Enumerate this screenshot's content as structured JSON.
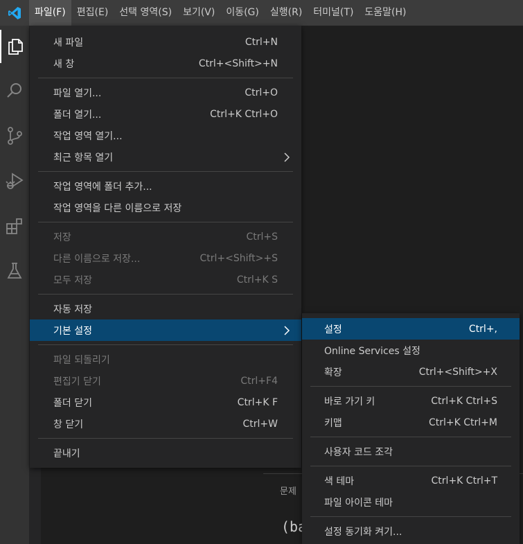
{
  "menubar": {
    "items": [
      {
        "label": "파일(F)",
        "active": true
      },
      {
        "label": "편집(E)"
      },
      {
        "label": "선택 영역(S)"
      },
      {
        "label": "보기(V)"
      },
      {
        "label": "이동(G)"
      },
      {
        "label": "실행(R)"
      },
      {
        "label": "터미널(T)"
      },
      {
        "label": "도움말(H)"
      }
    ]
  },
  "activitybar": {
    "icons": [
      "files-icon",
      "search-icon",
      "source-control-icon",
      "run-debug-icon",
      "extensions-icon",
      "testing-icon"
    ]
  },
  "file_menu": {
    "groups": [
      [
        {
          "label": "새 파일",
          "shortcut": "Ctrl+N"
        },
        {
          "label": "새 창",
          "shortcut": "Ctrl+<Shift>+N"
        }
      ],
      [
        {
          "label": "파일 열기...",
          "shortcut": "Ctrl+O"
        },
        {
          "label": "폴더 열기...",
          "shortcut": "Ctrl+K Ctrl+O"
        },
        {
          "label": "작업 영역 열기...",
          "shortcut": ""
        },
        {
          "label": "최근 항목 열기",
          "shortcut": "",
          "submenu": true
        }
      ],
      [
        {
          "label": "작업 영역에 폴더 추가...",
          "shortcut": ""
        },
        {
          "label": "작업 영역을 다른 이름으로 저장",
          "shortcut": ""
        }
      ],
      [
        {
          "label": "저장",
          "shortcut": "Ctrl+S",
          "disabled": true
        },
        {
          "label": "다른 이름으로 저장...",
          "shortcut": "Ctrl+<Shift>+S",
          "disabled": true
        },
        {
          "label": "모두 저장",
          "shortcut": "Ctrl+K S",
          "disabled": true
        }
      ],
      [
        {
          "label": "자동 저장",
          "shortcut": ""
        },
        {
          "label": "기본 설정",
          "shortcut": "",
          "submenu": true,
          "selected": true
        }
      ],
      [
        {
          "label": "파일 되돌리기",
          "shortcut": "",
          "disabled": true
        },
        {
          "label": "편집기 닫기",
          "shortcut": "Ctrl+F4",
          "disabled": true
        },
        {
          "label": "폴더 닫기",
          "shortcut": "Ctrl+K F"
        },
        {
          "label": "창 닫기",
          "shortcut": "Ctrl+W"
        }
      ],
      [
        {
          "label": "끝내기",
          "shortcut": ""
        }
      ]
    ]
  },
  "preferences_menu": {
    "groups": [
      [
        {
          "label": "설정",
          "shortcut": "Ctrl+,",
          "selected": true
        },
        {
          "label": "Online Services 설정",
          "shortcut": ""
        },
        {
          "label": "확장",
          "shortcut": "Ctrl+<Shift>+X"
        }
      ],
      [
        {
          "label": "바로 가기 키",
          "shortcut": "Ctrl+K Ctrl+S"
        },
        {
          "label": "키맵",
          "shortcut": "Ctrl+K Ctrl+M"
        }
      ],
      [
        {
          "label": "사용자 코드 조각",
          "shortcut": ""
        }
      ],
      [
        {
          "label": "색 테마",
          "shortcut": "Ctrl+K Ctrl+T"
        },
        {
          "label": "파일 아이콘 테마",
          "shortcut": ""
        }
      ],
      [
        {
          "label": "설정 동기화 켜기...",
          "shortcut": ""
        }
      ]
    ]
  },
  "panel": {
    "tab_label": "문제",
    "terminal_text": "(ba"
  },
  "colors": {
    "selection": "#094771",
    "menu_bg": "#252526",
    "titlebar_bg": "#3c3c3c",
    "activitybar_bg": "#333333",
    "logo": "#23a9f2"
  }
}
